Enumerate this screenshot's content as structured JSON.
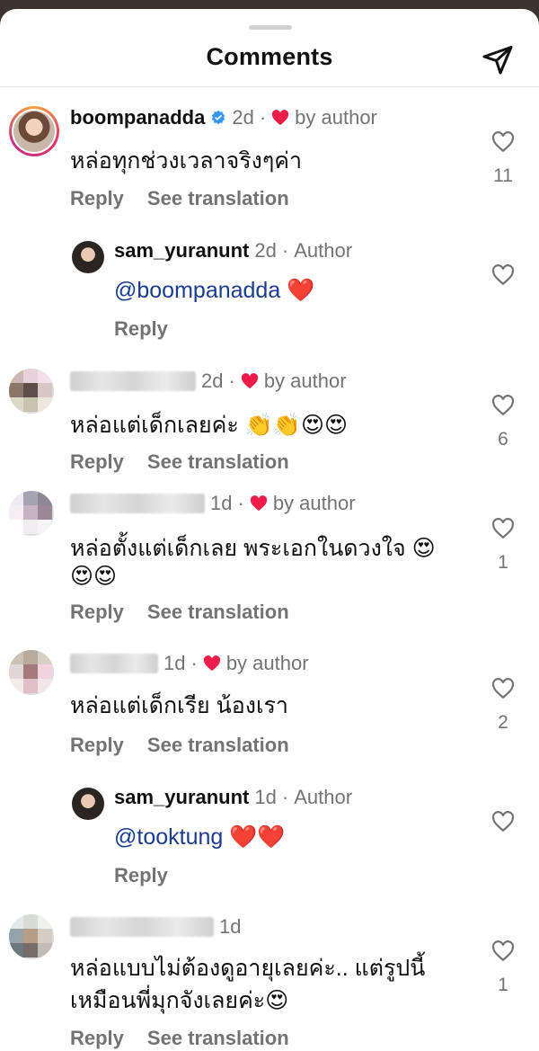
{
  "header": {
    "title": "Comments",
    "send_icon": "send-icon"
  },
  "comments": [
    {
      "username": "boompanadda",
      "verified": true,
      "time": "2d",
      "liked_by": "by author",
      "text": "หล่อทุกช่วงเวลาจริงๆค่า",
      "reply": "Reply",
      "translate": "See translation",
      "likes": "11"
    },
    {
      "username": "sam_yuranunt",
      "time": "2d",
      "badge": "Author",
      "mention": "@boompanadda",
      "text_emoji": "❤️",
      "reply": "Reply"
    },
    {
      "time": "2d",
      "liked_by": "by author",
      "text": "หล่อแต่เด็กเลยค่ะ",
      "text_emoji": "👏👏😍😍",
      "reply": "Reply",
      "translate": "See translation",
      "likes": "6"
    },
    {
      "time": "1d",
      "liked_by": "by author",
      "text": "หล่อตั้งแต่เด็กเลย พระเอกในดวงใจ",
      "text_emoji": "😍",
      "text_line2": "😍😍",
      "reply": "Reply",
      "translate": "See translation",
      "likes": "1"
    },
    {
      "time": "1d",
      "liked_by": "by author",
      "text": "หล่อแต่เด็กเรีย น้องเรา",
      "reply": "Reply",
      "translate": "See translation",
      "likes": "2"
    },
    {
      "username": "sam_yuranunt",
      "time": "1d",
      "badge": "Author",
      "mention": "@tooktung",
      "text_emoji": "❤️❤️",
      "reply": "Reply"
    },
    {
      "time": "1d",
      "text": "หล่อแบบไม่ต้องดูอายุเลยค่ะ.. แต่รูปนี้",
      "text_line2": "เหมือนพี่มุกจังเลยค่ะ",
      "text_emoji": "😍",
      "reply": "Reply",
      "translate": "See translation",
      "likes": "1"
    }
  ],
  "colors": {
    "accent_heart": "#ed1c4a",
    "muted": "#737373",
    "mention": "#1a3d8f",
    "verified": "#3897f0"
  }
}
